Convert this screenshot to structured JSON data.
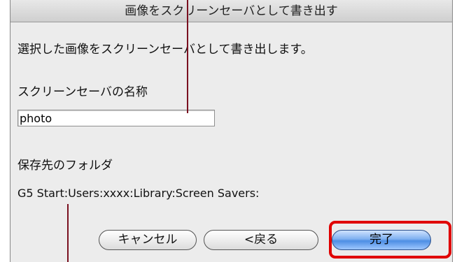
{
  "dialog": {
    "title": "画像をスクリーンセーバとして書き出す",
    "message": "選択した画像をスクリーンセーバとして書き出します。",
    "name_label": "スクリーンセーバの名称",
    "name_value": "photo",
    "folder_label": "保存先のフォルダ",
    "folder_path": "G5 Start:Users:xxxx:Library:Screen Savers:"
  },
  "buttons": {
    "cancel": "キャンセル",
    "back": "<戻る",
    "done": "完了"
  },
  "colors": {
    "highlight": "#e00000",
    "callout_line": "#7a1020",
    "default_button": "#4d8ee4"
  }
}
